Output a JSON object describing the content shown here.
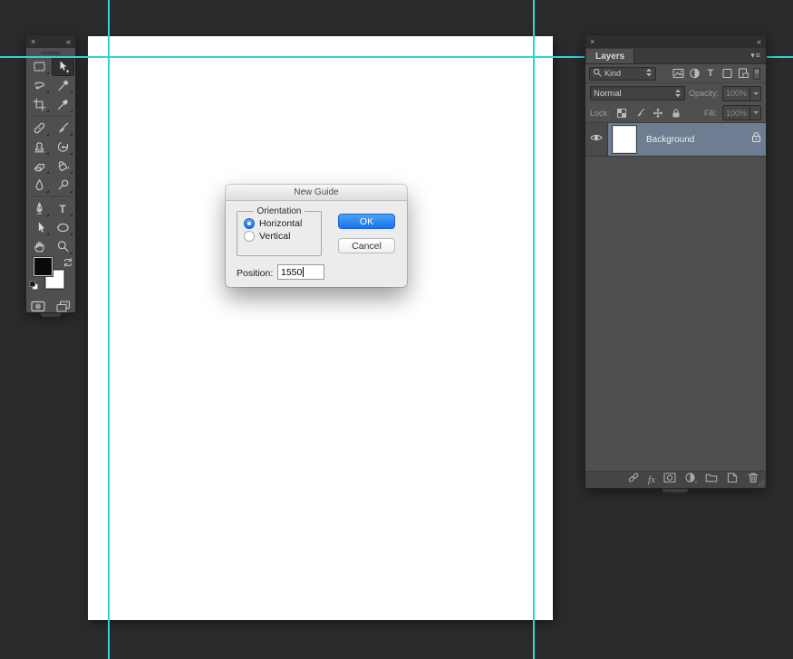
{
  "colors": {
    "app_bg": "#2b2b2b",
    "panel_bg": "#4f4f4f",
    "panel_header_bg": "#2e2e2e",
    "guide": "#2dd4d8",
    "selected_layer_bg": "#6e7d92",
    "accent_blue": "#1b71ec",
    "canvas": "#ffffff"
  },
  "toolbar": {
    "close_glyph": "×",
    "collapse_glyph": "«",
    "selected_tool": "move",
    "type_tool_glyph": "T",
    "tools": [
      "rectangular-marquee",
      "move",
      "lasso",
      "magic-wand",
      "crop",
      "eyedropper",
      "healing-brush",
      "brush",
      "clone-stamp",
      "history-brush",
      "eraser",
      "paint-bucket",
      "blur",
      "dodge",
      "pen",
      "type",
      "path-selection",
      "ellipse-shape",
      "hand",
      "zoom"
    ],
    "foreground_color": "#0a0a0a",
    "background_color": "#ffffff"
  },
  "dialog": {
    "title": "New Guide",
    "orientation_legend": "Orientation",
    "radio_horizontal": "Horizontal",
    "radio_vertical": "Vertical",
    "selected_orientation": "Horizontal",
    "ok_label": "OK",
    "cancel_label": "Cancel",
    "position_label": "Position:",
    "position_value": "1550"
  },
  "layers_panel": {
    "close_glyph": "×",
    "collapse_glyph": "«",
    "tab_label": "Layers",
    "panel_menu_glyph": "▾≡",
    "filter_label": "Kind",
    "type_filter_glyph": "T",
    "filter_icons": [
      "pixel-layer-filter",
      "adjustment-layer-filter",
      "type-layer-filter",
      "shape-layer-filter",
      "smart-object-filter",
      "filter-toggle-switch"
    ],
    "blend_mode": "Normal",
    "opacity_label": "Opacity:",
    "opacity_value": "100%",
    "lock_label": "Lock:",
    "lock_icons": [
      "lock-transparency",
      "lock-image",
      "lock-position",
      "lock-all"
    ],
    "fill_label": "Fill:",
    "fill_value": "100%",
    "fx_glyph": "fx",
    "bottom_icons": [
      "link-layers",
      "layer-style-fx",
      "add-layer-mask",
      "new-adjustment-layer",
      "new-group-folder",
      "new-layer",
      "delete-layer-trash"
    ],
    "layers": [
      {
        "name": "Background",
        "visible": true,
        "locked": true,
        "selected": true,
        "thumbnail_color": "#ffffff"
      }
    ]
  },
  "guides": {
    "vertical_x": [
      119,
      588
    ],
    "horizontal_y": [
      62
    ]
  }
}
